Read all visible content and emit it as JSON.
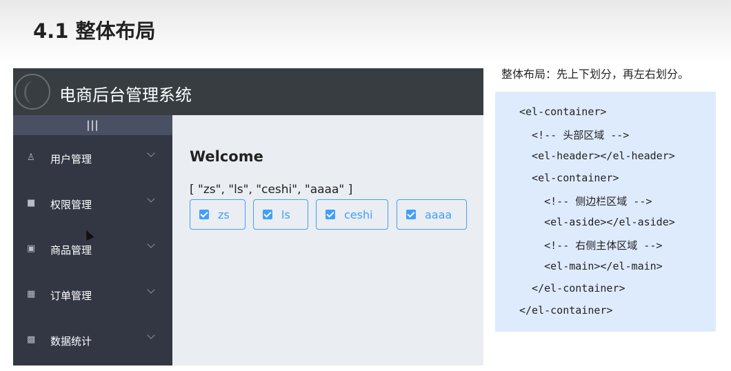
{
  "slide": {
    "title": "4.1 整体布局"
  },
  "app": {
    "title": "电商后台管理系统",
    "toggle_label": "|||",
    "menu": [
      {
        "label": "用户管理",
        "icon": "user-icon"
      },
      {
        "label": "权限管理",
        "icon": "cube-icon"
      },
      {
        "label": "商品管理",
        "icon": "bag-icon"
      },
      {
        "label": "订单管理",
        "icon": "clipboard-icon"
      },
      {
        "label": "数据统计",
        "icon": "chart-icon"
      }
    ],
    "main": {
      "welcome": "Welcome",
      "array_text": "[ \"zs\", \"ls\", \"ceshi\", \"aaaa\" ]",
      "checkboxes": [
        "zs",
        "ls",
        "ceshi",
        "aaaa"
      ]
    },
    "accent_color": "#409eff",
    "header_color": "#373d41",
    "aside_color": "#333744"
  },
  "explanation": {
    "text": "整体布局：先上下划分，再左右划分。",
    "code": [
      "<el-container>",
      "  <!-- 头部区域 -->",
      "  <el-header></el-header>",
      "  <el-container>",
      "    <!-- 侧边栏区域 -->",
      "    <el-aside></el-aside>",
      "    <!-- 右侧主体区域 -->",
      "    <el-main></el-main>",
      "  </el-container>",
      "</el-container>"
    ]
  }
}
